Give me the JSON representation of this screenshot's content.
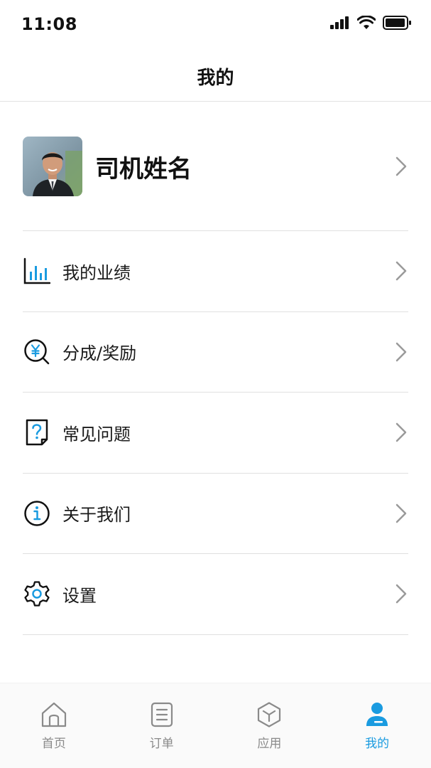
{
  "status_bar": {
    "time": "11:08"
  },
  "nav": {
    "title": "我的"
  },
  "profile": {
    "name": "司机姓名"
  },
  "menu": [
    {
      "label": "我的业绩",
      "icon": "bar-chart-icon"
    },
    {
      "label": "分成/奖励",
      "icon": "yuan-search-icon"
    },
    {
      "label": "常见问题",
      "icon": "question-document-icon"
    },
    {
      "label": "关于我们",
      "icon": "info-icon"
    },
    {
      "label": "设置",
      "icon": "gear-icon"
    }
  ],
  "tabs": [
    {
      "label": "首页",
      "icon": "home-icon",
      "active": false
    },
    {
      "label": "订单",
      "icon": "order-list-icon",
      "active": false
    },
    {
      "label": "应用",
      "icon": "cube-icon",
      "active": false
    },
    {
      "label": "我的",
      "icon": "user-icon",
      "active": true
    }
  ],
  "colors": {
    "accent": "#1a9be0",
    "inactive": "#8a8a8a",
    "divider": "#e0e0e0"
  }
}
